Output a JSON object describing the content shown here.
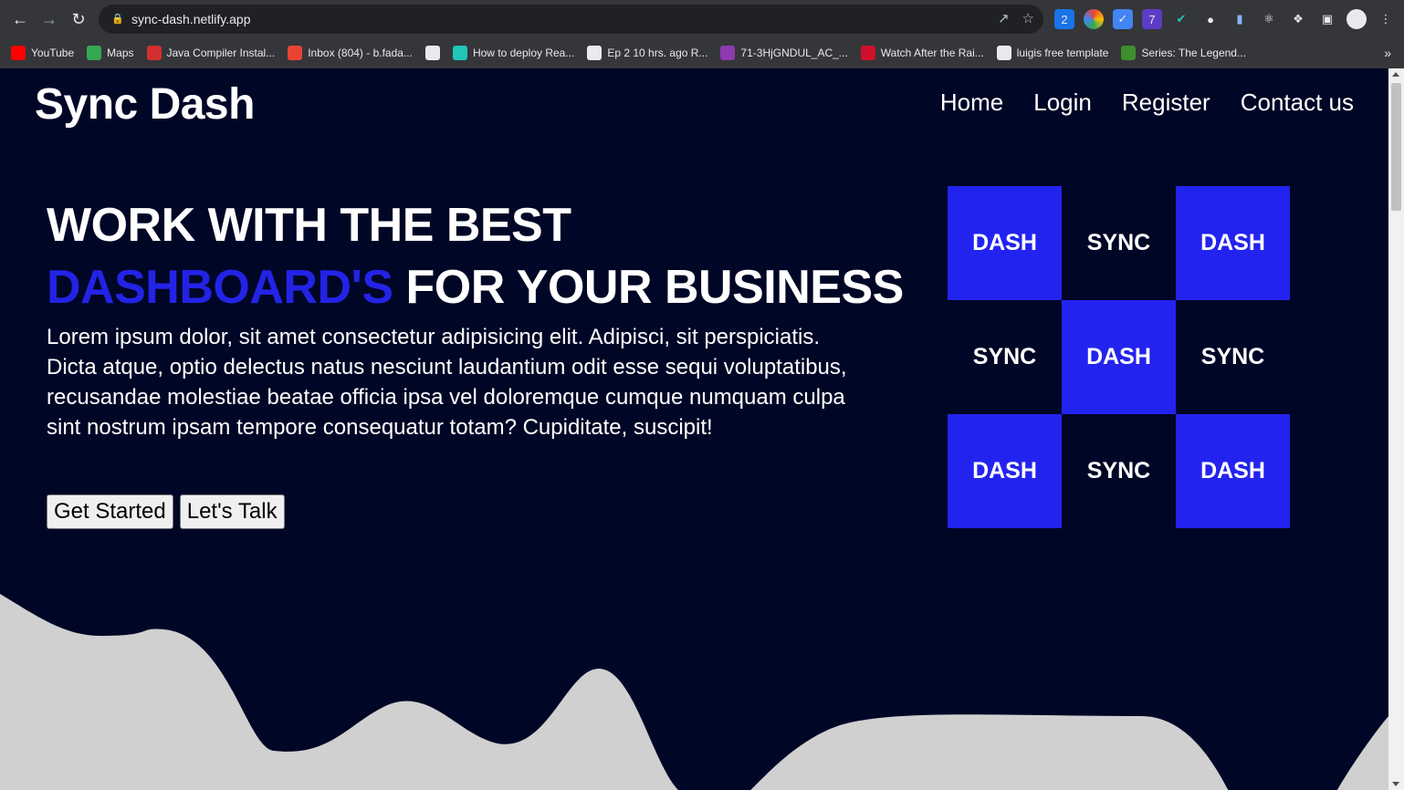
{
  "browser": {
    "url": "sync-dash.netlify.app",
    "bookmarks": [
      {
        "label": "YouTube",
        "icon": "youtube-icon",
        "color": "#ff0000"
      },
      {
        "label": "Maps",
        "icon": "maps-icon",
        "color": "#34a853"
      },
      {
        "label": "Java Compiler Instal...",
        "icon": "java-icon",
        "color": "#d32f2f"
      },
      {
        "label": "Inbox (804) - b.fada...",
        "icon": "gmail-icon",
        "color": "#ea4335"
      },
      {
        "label": "",
        "icon": "globe-icon",
        "color": "#e8eaed"
      },
      {
        "label": "How to deploy Rea...",
        "icon": "netlify-icon",
        "color": "#20c6b7"
      },
      {
        "label": "Ep 2 10 hrs. ago R...",
        "icon": "globe-icon",
        "color": "#e8eaed"
      },
      {
        "label": "71-3HjGNDUL_AC_...",
        "icon": "image-icon",
        "color": "#8e3ab0"
      },
      {
        "label": "Watch After the Rai...",
        "icon": "ak-icon",
        "color": "#d0102a"
      },
      {
        "label": "luigis free template",
        "icon": "globe-icon",
        "color": "#e8eaed"
      },
      {
        "label": "Series: The Legend...",
        "icon": "n-icon",
        "color": "#3e8e2e"
      }
    ]
  },
  "site": {
    "brand": "Sync Dash",
    "nav": [
      "Home",
      "Login",
      "Register",
      "Contact us"
    ],
    "hero": {
      "line1": "WORK WITH THE BEST",
      "accent": "DASHBOARD'S",
      "line2_rest": " FOR YOUR BUSINESS",
      "text": "Lorem ipsum dolor, sit amet consectetur adipisicing elit. Adipisci, sit perspiciatis. Dicta atque, optio delectus natus nesciunt laudantium odit esse sequi voluptatibus, recusandae molestiae beatae officia ipsa vel doloremque cumque numquam culpa sint nostrum ipsam tempore consequatur totam? Cupiditate, suscipit!",
      "primary_button": "Get Started",
      "secondary_button": "Let's Talk"
    },
    "grid": [
      {
        "label": "DASH",
        "blue": true
      },
      {
        "label": "SYNC",
        "blue": false
      },
      {
        "label": "DASH",
        "blue": true
      },
      {
        "label": "SYNC",
        "blue": false
      },
      {
        "label": "DASH",
        "blue": true
      },
      {
        "label": "SYNC",
        "blue": false
      },
      {
        "label": "DASH",
        "blue": true
      },
      {
        "label": "SYNC",
        "blue": false
      },
      {
        "label": "DASH",
        "blue": true
      }
    ],
    "colors": {
      "background": "#000626",
      "accent": "#2323e6",
      "tile": "#2323f0",
      "wave": "#d0d0d0"
    }
  }
}
